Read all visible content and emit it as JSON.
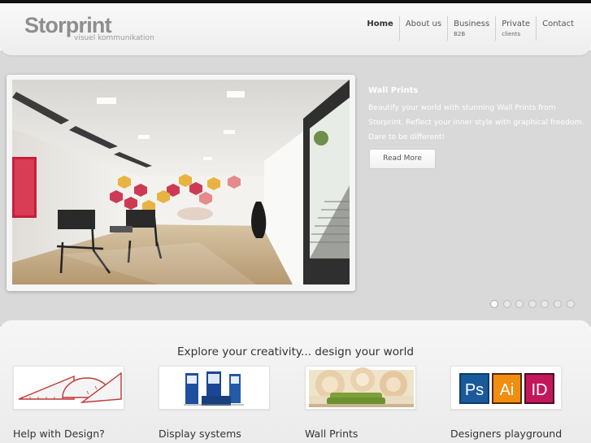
{
  "brand": {
    "name": "Storprint",
    "tagline": "visuel kommunikation"
  },
  "nav": {
    "items": [
      {
        "label": "Home",
        "sub": "",
        "active": true
      },
      {
        "label": "About us",
        "sub": ""
      },
      {
        "label": "Business",
        "sub": "B2B"
      },
      {
        "label": "Private",
        "sub": "clients"
      },
      {
        "label": "Contact",
        "sub": ""
      }
    ]
  },
  "slider": {
    "title": "Wall Prints",
    "text": "Beautify your world with stunning Wall Prints from Storprint. Reflect your inner style with graphical freedom. Dare to be different!",
    "button": "Read More",
    "slide_count": 7,
    "active_slide": 1
  },
  "content": {
    "tagline": "Explore your creativity... design your world",
    "features": [
      {
        "title": "Help with Design?"
      },
      {
        "title": "Display systems"
      },
      {
        "title": "Wall Prints"
      },
      {
        "title": "Designers playground"
      }
    ]
  },
  "icons": {
    "photoshop": "Ps",
    "illustrator": "Ai",
    "indesign": "ID"
  },
  "colors": {
    "hero_bg": "#d9d9d9",
    "logo_gray": "#8e8e8e"
  }
}
